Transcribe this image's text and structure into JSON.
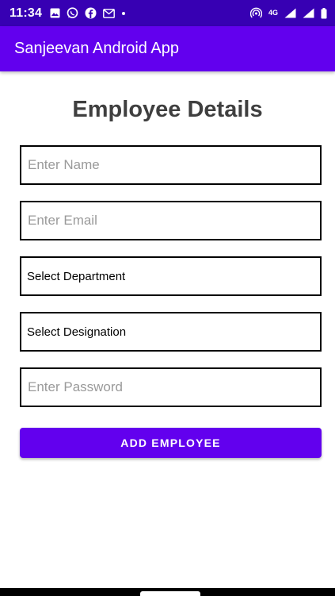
{
  "status_bar": {
    "time": "11:34",
    "network_label": "4G",
    "left_icons": [
      "image-icon",
      "whatsapp-icon",
      "facebook-icon",
      "gmail-icon",
      "dot-icon"
    ],
    "right_icons": [
      "hotspot-icon",
      "network-4g-icon",
      "wifi-signal-icon",
      "cell-signal-icon",
      "battery-icon"
    ]
  },
  "app_bar": {
    "title": "Sanjeevan Android App"
  },
  "form": {
    "title": "Employee Details",
    "name_placeholder": "Enter Name",
    "email_placeholder": "Enter Email",
    "department_select": "Select Department",
    "designation_select": "Select Designation",
    "password_placeholder": "Enter Password",
    "submit_label": "ADD EMPLOYEE"
  },
  "colors": {
    "status_bar": "#3700b3",
    "primary": "#6200ee",
    "title_text": "#3f3f3f",
    "placeholder": "#9a9a9a"
  }
}
